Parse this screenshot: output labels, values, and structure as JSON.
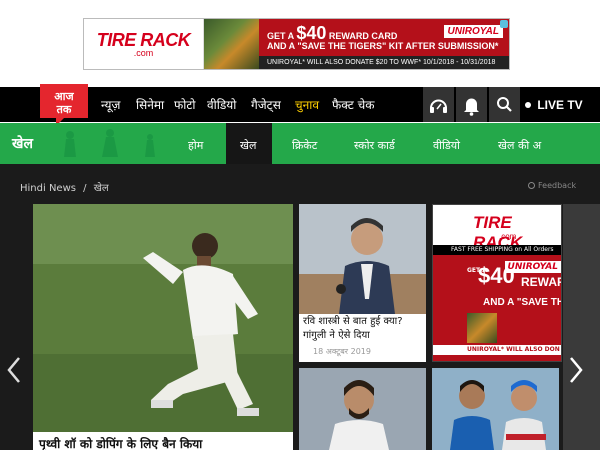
{
  "ad_banner": {
    "brand": "TIRE RACK",
    "brand_sub": ".com",
    "line1_pre": "GET A",
    "line1_amount": "$40",
    "line1_post": "REWARD CARD",
    "line2": "AND A \"SAVE THE TIGERS\" KIT AFTER SUBMISSION*",
    "line3": "UNIROYAL* WILL ALSO DONATE $20 TO WWF*   10/1/2018 - 10/31/2018",
    "partner": "UNIROYAL"
  },
  "nav": {
    "logo_text": "आज तक",
    "links": [
      "न्यूज़",
      "सिनेमा",
      "फोटो",
      "वीडियो",
      "गैजेट्स",
      "चुनाव",
      "फैक्ट चेक"
    ],
    "live_tv": "LIVE TV"
  },
  "section": {
    "title": "खेल",
    "sub_links": [
      "होम",
      "खेल",
      "क्रिकेट",
      "स्कोर कार्ड",
      "वीडियो",
      "खेल की अ"
    ]
  },
  "breadcrumb": {
    "home": "Hindi News",
    "separator": "/",
    "current": "खेल"
  },
  "feedback": "Feedback",
  "cards": {
    "main_caption": "पृथ्वी शॉ को डोपिंग के लिए बैन किया",
    "card2_title": "रवि शास्त्री से बात हुई क्या? गांगुली ने ऐसे दिया",
    "card2_date": "18 अक्टूबर 2019"
  },
  "side_ad": {
    "brand": "TIRE RACK",
    "brand_sub": ".com",
    "ship": "FAST FREE SHIPPING on All Orders",
    "get_a": "GET A",
    "amount": "$40",
    "reward": "REWARD",
    "save": "AND A \"SAVE THE TIGER",
    "uniroyal": "UNIROYAL",
    "uni_line": "UNIROYAL* WILL ALSO DON"
  },
  "colors": {
    "nav_bg": "#000000",
    "green": "#24a84a",
    "dark_bg": "#1b1b1b",
    "logo_red": "#e4262e",
    "highlight": "#ffd000"
  }
}
